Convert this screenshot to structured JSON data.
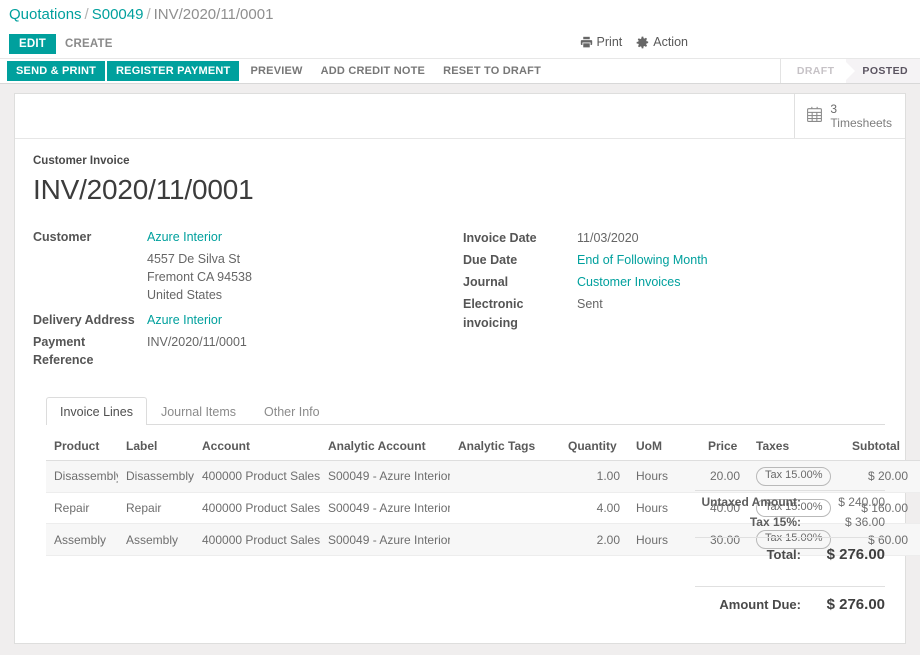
{
  "breadcrumb": {
    "root": "Quotations",
    "parent": "S00049",
    "current": "INV/2020/11/0001",
    "separator": "/"
  },
  "control_bar": {
    "edit_label": "EDIT",
    "create_label": "CREATE",
    "print_label": "Print",
    "action_label": "Action",
    "print_icon": "printer-icon",
    "action_icon": "gear-icon"
  },
  "status_bar": {
    "buttons": [
      {
        "label": "SEND & PRINT",
        "style": "primary"
      },
      {
        "label": "REGISTER PAYMENT",
        "style": "primary"
      },
      {
        "label": "PREVIEW",
        "style": "flat"
      },
      {
        "label": "ADD CREDIT NOTE",
        "style": "flat"
      },
      {
        "label": "RESET TO DRAFT",
        "style": "flat"
      }
    ],
    "stages": [
      {
        "label": "DRAFT",
        "active": false
      },
      {
        "label": "POSTED",
        "active": true
      }
    ]
  },
  "smart_button": {
    "icon": "calendar-icon",
    "value": "3",
    "label": "Timesheets"
  },
  "document": {
    "type_label": "Customer Invoice",
    "title": "INV/2020/11/0001"
  },
  "fields_left": {
    "customer_label": "Customer",
    "customer_value": "Azure Interior",
    "customer_address": [
      "4557 De Silva St",
      "Fremont CA 94538",
      "United States"
    ],
    "delivery_label": "Delivery Address",
    "delivery_value": "Azure Interior",
    "payment_ref_label": "Payment Reference",
    "payment_ref_value": "INV/2020/11/0001"
  },
  "fields_right": {
    "invoice_date_label": "Invoice Date",
    "invoice_date_value": "11/03/2020",
    "due_date_label": "Due Date",
    "due_date_value": "End of Following Month",
    "journal_label": "Journal",
    "journal_value": "Customer Invoices",
    "einvoicing_label": "Electronic invoicing",
    "einvoicing_value": "Sent"
  },
  "tabs": [
    {
      "label": "Invoice Lines",
      "active": true
    },
    {
      "label": "Journal Items",
      "active": false
    },
    {
      "label": "Other Info",
      "active": false
    }
  ],
  "table": {
    "columns": [
      "Product",
      "Label",
      "Account",
      "Analytic Account",
      "Analytic Tags",
      "Quantity",
      "UoM",
      "Price",
      "Taxes",
      "Subtotal"
    ],
    "options_icon": "vertical-dots-icon",
    "rows": [
      {
        "product": "Disassembly",
        "label": "Disassembly",
        "account": "400000 Product Sales",
        "analytic_account": "S00049 - Azure Interior",
        "analytic_tags": "",
        "quantity": "1.00",
        "uom": "Hours",
        "price": "20.00",
        "taxes": "Tax 15.00%",
        "subtotal": "$ 20.00"
      },
      {
        "product": "Repair",
        "label": "Repair",
        "account": "400000 Product Sales",
        "analytic_account": "S00049 - Azure Interior",
        "analytic_tags": "",
        "quantity": "4.00",
        "uom": "Hours",
        "price": "40.00",
        "taxes": "Tax 15.00%",
        "subtotal": "$ 160.00"
      },
      {
        "product": "Assembly",
        "label": "Assembly",
        "account": "400000 Product Sales",
        "analytic_account": "S00049 - Azure Interior",
        "analytic_tags": "",
        "quantity": "2.00",
        "uom": "Hours",
        "price": "30.00",
        "taxes": "Tax 15.00%",
        "subtotal": "$ 60.00"
      }
    ]
  },
  "totals": {
    "untaxed_label": "Untaxed Amount:",
    "untaxed_value": "$ 240.00",
    "tax_label": "Tax 15%:",
    "tax_value": "$ 36.00",
    "total_label": "Total:",
    "total_value": "$ 276.00",
    "due_label": "Amount Due:",
    "due_value": "$ 276.00"
  },
  "colors": {
    "accent": "#00a09d",
    "page_bg": "#f0eeee",
    "link": "#00a09d"
  }
}
